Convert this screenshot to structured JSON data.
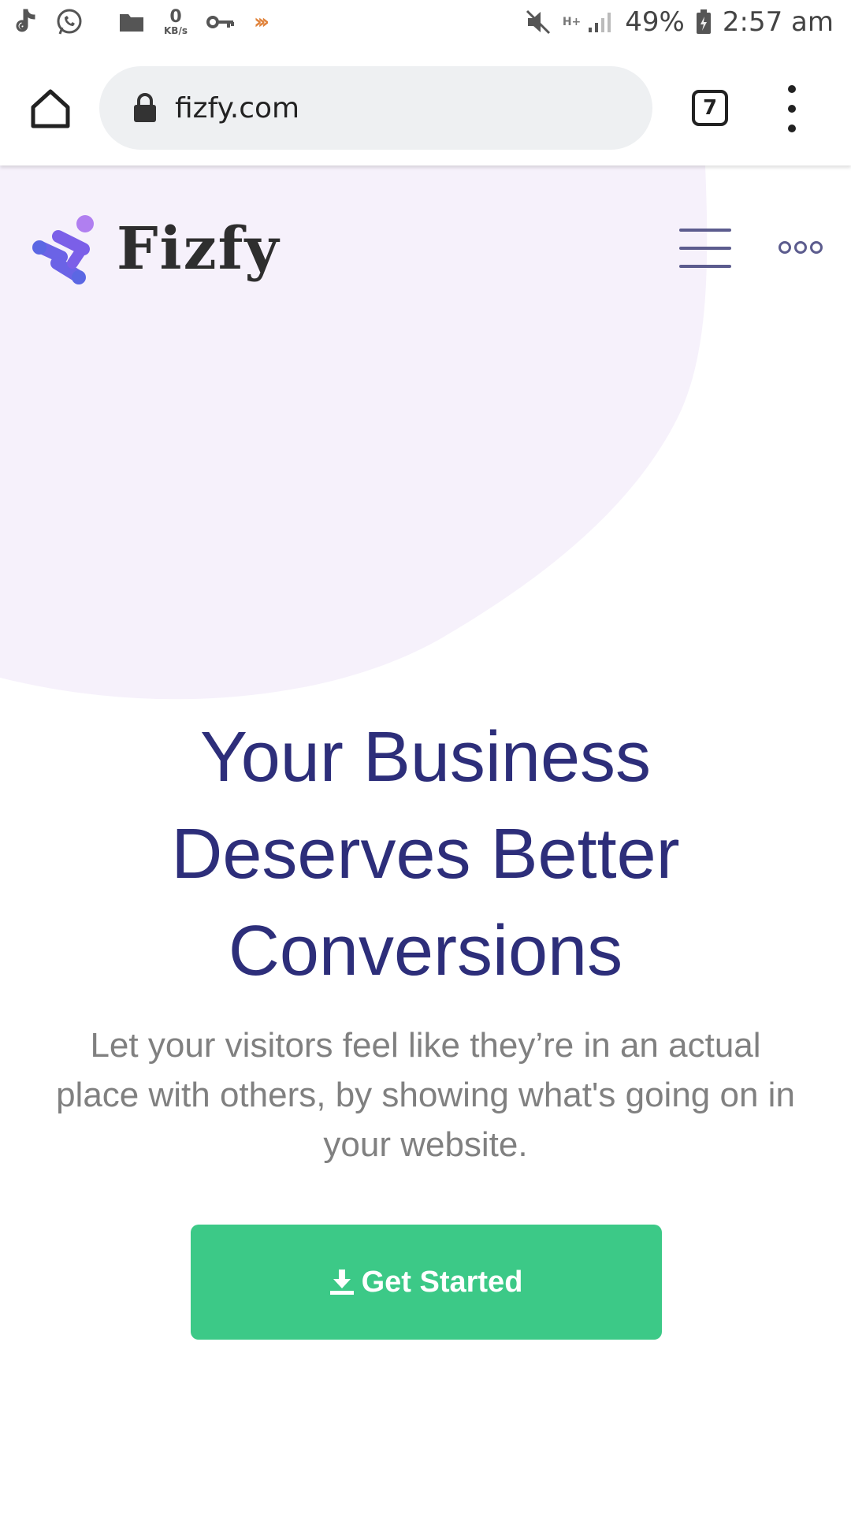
{
  "status_bar": {
    "net_speed": "0",
    "net_unit": "KB/s",
    "network_type": "H+",
    "battery": "49%",
    "time": "2:57 am"
  },
  "browser": {
    "url": "fizfy.com",
    "tab_count": "7"
  },
  "site": {
    "brand": "Fizfy",
    "hero_title_lines": [
      "Your Business",
      "Deserves Better",
      "Conversions"
    ],
    "hero_subtitle": "Let your visitors feel like they’re in an actual place with others, by showing what's going on in your website.",
    "cta_label": "Get Started"
  },
  "colors": {
    "title": "#2d2e7a",
    "cta": "#3cc987",
    "blob": "#f6f1fb",
    "logo_purple": "#7b5fe8"
  },
  "icons": {
    "status_left": [
      "tiktok-icon",
      "whatsapp-icon",
      "folder-icon",
      "key-icon",
      "forward-arrows-icon"
    ],
    "status_right": [
      "mute-icon",
      "signal-icon",
      "battery-icon"
    ],
    "browser": [
      "home-icon",
      "lock-icon",
      "tabs-icon",
      "more-vert-icon"
    ],
    "site": [
      "hamburger-icon",
      "more-horiz-icon",
      "download-icon"
    ]
  }
}
